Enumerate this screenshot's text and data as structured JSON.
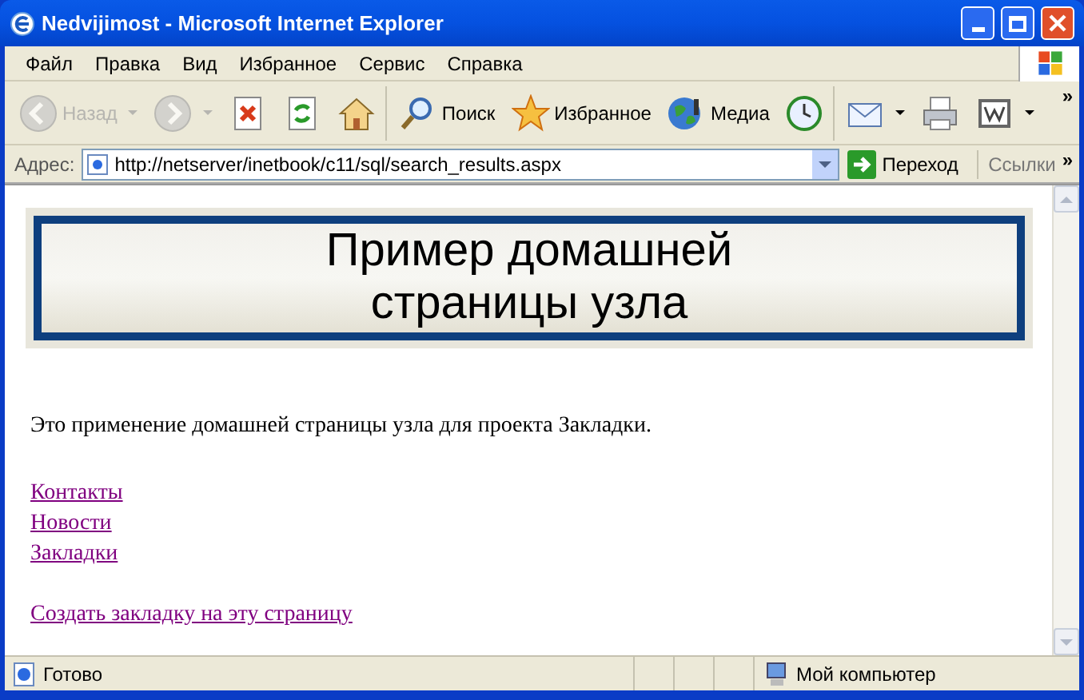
{
  "window": {
    "title": "Nedvijimost - Microsoft Internet Explorer"
  },
  "menu": [
    "Файл",
    "Правка",
    "Вид",
    "Избранное",
    "Сервис",
    "Справка"
  ],
  "toolbar": [
    {
      "kind": "back",
      "label": "Назад",
      "disabled": true
    },
    {
      "kind": "forward",
      "disabled": true
    },
    {
      "kind": "stop",
      "disabled": false
    },
    {
      "kind": "refresh",
      "disabled": false
    },
    {
      "kind": "home",
      "disabled": false
    },
    {
      "kind": "search",
      "label": "Поиск",
      "disabled": false
    },
    {
      "kind": "favorites",
      "label": "Избранное",
      "disabled": false
    },
    {
      "kind": "media",
      "label": "Медиа",
      "disabled": false
    },
    {
      "kind": "history",
      "disabled": false
    },
    {
      "kind": "mail",
      "disabled": false
    },
    {
      "kind": "print",
      "disabled": false
    },
    {
      "kind": "edit",
      "disabled": false
    }
  ],
  "toolbar_overflow": "»",
  "address_bar": {
    "label": "Адрес:",
    "value": "http://netserver/inetbook/c11/sql/search_results.aspx",
    "go": "Переход",
    "links": "Ссылки",
    "links_overflow": "»"
  },
  "page": {
    "banner": [
      "Пример домашней",
      "страницы узла"
    ],
    "intro": "Это применение домашней страницы узла для проекта Закладки.",
    "links": [
      "Контакты",
      "Новости",
      "Закладки"
    ],
    "bookmark_link": "Создать закладку на эту страницу"
  },
  "status_bar": {
    "text": "Готово",
    "zone": "Мой компьютер"
  }
}
